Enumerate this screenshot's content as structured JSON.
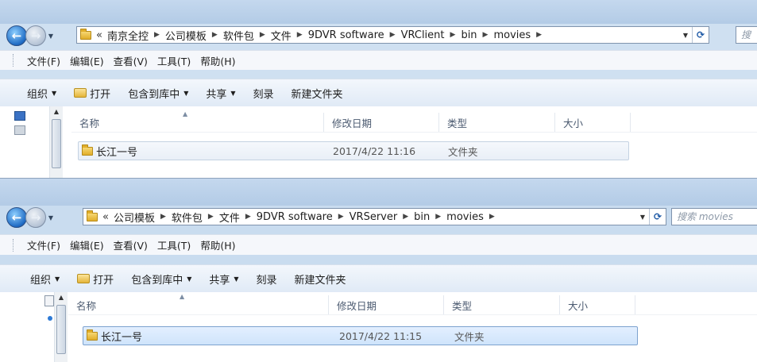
{
  "window1": {
    "address": {
      "overflow_symbol": "«",
      "segments": [
        "南京全控",
        "公司模板",
        "软件包",
        "文件",
        "9DVR software",
        "VRClient",
        "bin",
        "movies"
      ]
    },
    "search_placeholder": "搜"
  },
  "window2": {
    "address": {
      "overflow_symbol": "«",
      "segments": [
        "公司模板",
        "软件包",
        "文件",
        "9DVR software",
        "VRServer",
        "bin",
        "movies"
      ]
    },
    "search_placeholder": "搜索 movies"
  },
  "menubar": [
    "文件(F)",
    "编辑(E)",
    "查看(V)",
    "工具(T)",
    "帮助(H)"
  ],
  "toolbar": {
    "organize": "组织",
    "open": "打开",
    "include_in_library": "包含到库中",
    "share": "共享",
    "burn": "刻录",
    "new_folder": "新建文件夹"
  },
  "columns": {
    "name": "名称",
    "date_modified": "修改日期",
    "type": "类型",
    "size": "大小"
  },
  "window1_files": [
    {
      "name": "长江一号",
      "date": "2017/4/22 11:16",
      "type": "文件夹",
      "size": ""
    }
  ],
  "window2_files": [
    {
      "name": "长江一号",
      "date": "2017/4/22 11:15",
      "type": "文件夹",
      "size": ""
    }
  ],
  "colors": {
    "selection": "#cfe4fb",
    "frame": "#c9dcef",
    "accent": "#1f6bc4"
  }
}
